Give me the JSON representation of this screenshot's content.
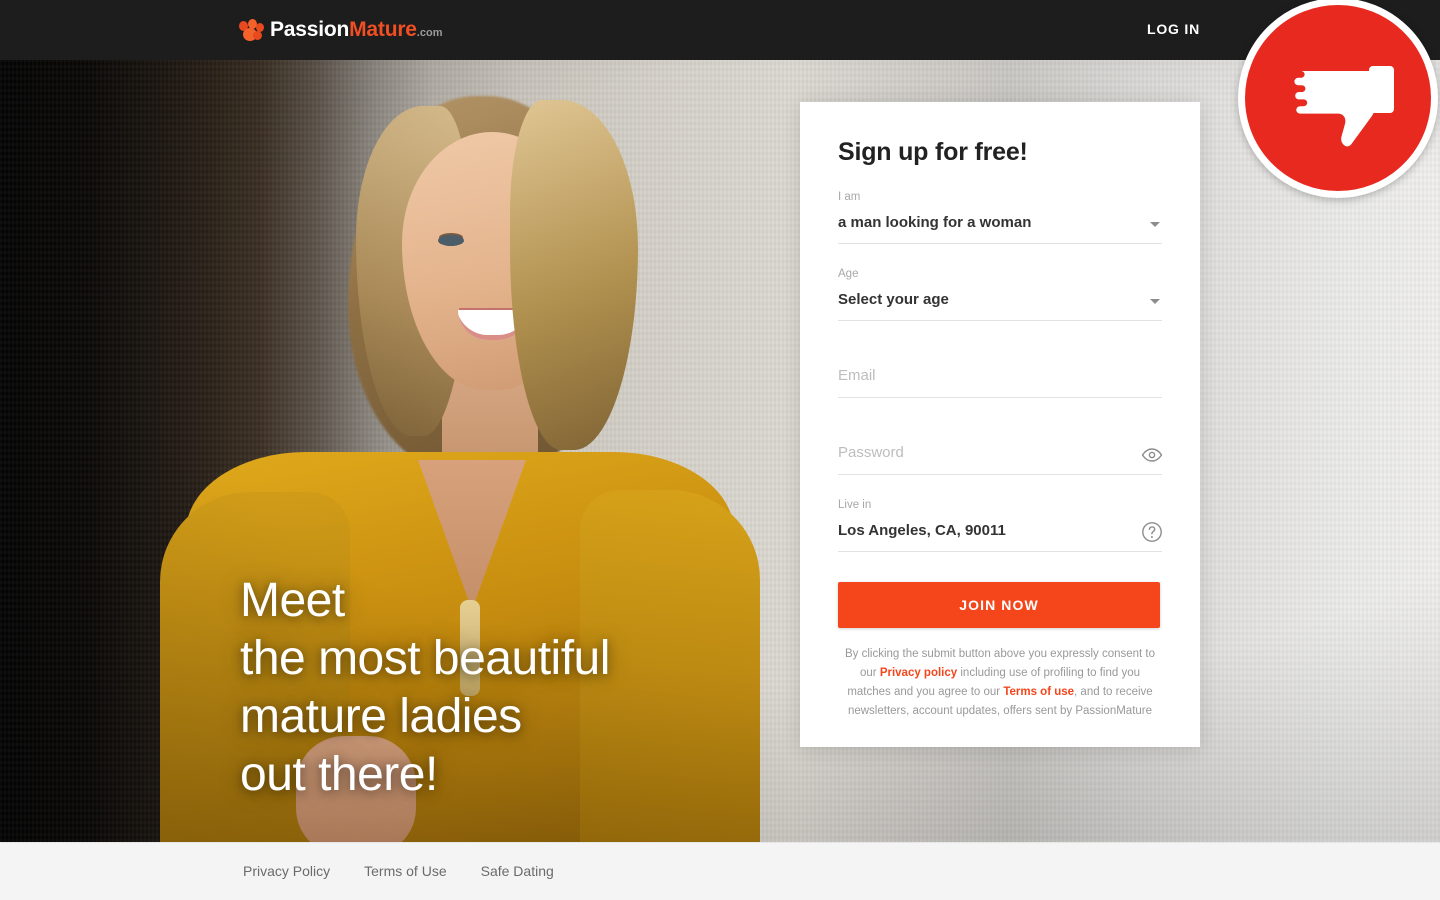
{
  "header": {
    "logo": {
      "icon": "paw-cluster-icon",
      "part1": "Passion",
      "part2": "Mature",
      "part3": ".com"
    },
    "login_label": "LOG IN"
  },
  "hero": {
    "headline_lines": [
      "Meet",
      "the most beautiful",
      "mature ladies",
      "out there!"
    ]
  },
  "signup": {
    "title": "Sign up for free!",
    "fields": [
      {
        "label": "I am",
        "value": "a man looking for a woman",
        "type": "select",
        "icon": "chevron-down-icon"
      },
      {
        "label": "Age",
        "value": "Select your age",
        "type": "select",
        "icon": "chevron-down-icon"
      },
      {
        "label": "",
        "placeholder": "Email",
        "value": "",
        "type": "text",
        "icon": ""
      },
      {
        "label": "",
        "placeholder": "Password",
        "value": "",
        "type": "password",
        "icon": "eye-icon"
      },
      {
        "label": "Live in",
        "value": "Los Angeles, CA, 90011",
        "type": "text",
        "icon": "help-circle-icon"
      }
    ],
    "submit_label": "JOIN NOW",
    "consent": {
      "part1": "By clicking the submit button above you expressly consent to our ",
      "link1": "Privacy policy",
      "part2": " including use of profiling to find you matches and you agree to our ",
      "link2": "Terms of use",
      "part3": ", and to receive newsletters, account updates, offers sent by PassionMature"
    }
  },
  "footer": {
    "links": [
      "Privacy Policy",
      "Terms of Use",
      "Safe Dating"
    ]
  },
  "overlay": {
    "badge_icon": "thumbs-down-icon",
    "badge_color": "#e8291f"
  },
  "colors": {
    "accent": "#f4451b",
    "header_bg": "#1d1d1d",
    "badge_red": "#e8291f",
    "footer_bg": "#f4f4f4"
  }
}
